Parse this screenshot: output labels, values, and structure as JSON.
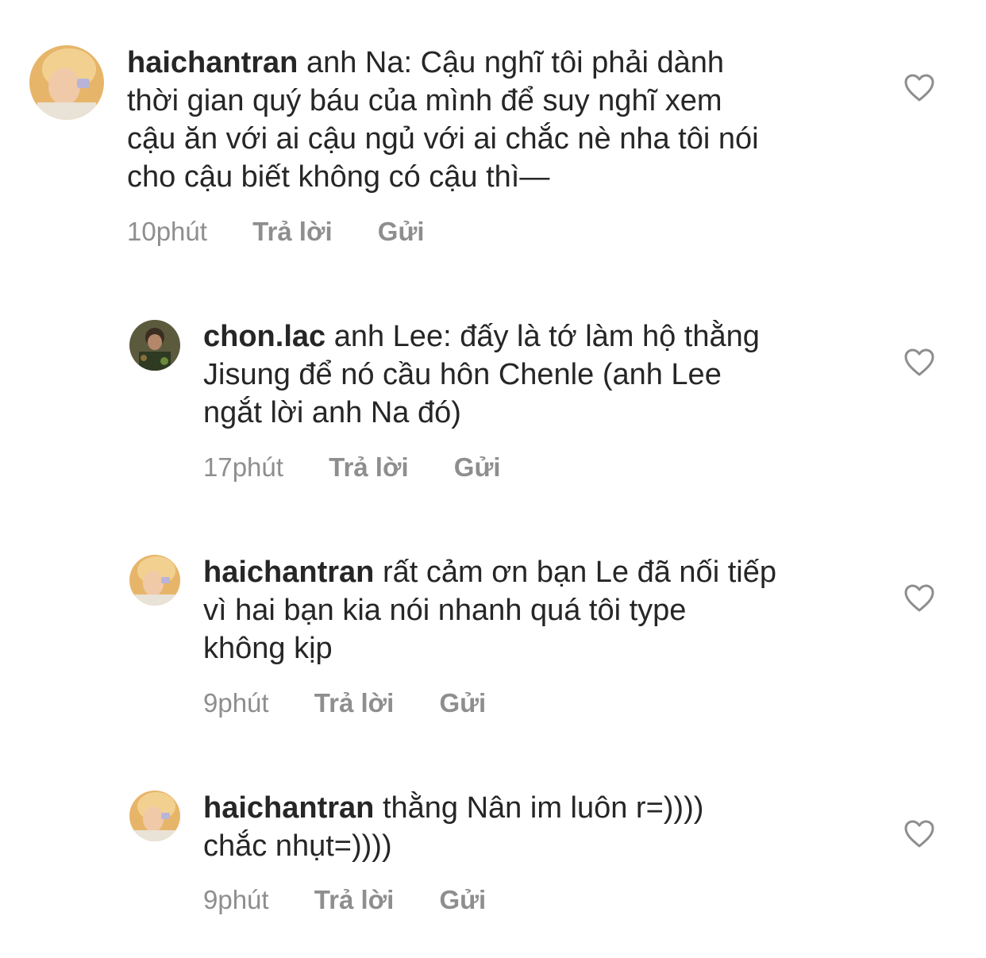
{
  "comments": [
    {
      "username": "haichantran",
      "text": "anh Na: Cậu nghĩ tôi phải dành\nthời gian quý báu của mình để suy nghĩ xem\ncậu ăn với ai cậu ngủ với ai chắc nè nha tôi nói\ncho cậu biết không có cậu thì—",
      "time": "10phút",
      "reply_label": "Trả lời",
      "send_label": "Gửi"
    },
    {
      "username": "chon.lac",
      "text": "anh Lee: đấy là tớ làm hộ thằng\nJisung để nó cầu hôn Chenle (anh Lee\nngắt lời anh Na đó)",
      "time": "17phút",
      "reply_label": "Trả lời",
      "send_label": "Gửi"
    },
    {
      "username": "haichantran",
      "text": "rất cảm ơn bạn Le đã nối tiếp\nvì hai bạn kia nói nhanh quá tôi type\nkhông kịp",
      "time": "9phút",
      "reply_label": "Trả lời",
      "send_label": "Gửi"
    },
    {
      "username": "haichantran",
      "text": "thằng Nân im luôn r=))))\nchắc nhụt=))))",
      "time": "9phút",
      "reply_label": "Trả lời",
      "send_label": "Gửi"
    }
  ],
  "icons": {
    "like": "heart-outline-icon",
    "avatar_main": "avatar-haichantran",
    "avatar_reply": "avatar-chon-lac"
  },
  "colors": {
    "text": "#262626",
    "secondary": "#8e8e8e",
    "background": "#ffffff"
  }
}
